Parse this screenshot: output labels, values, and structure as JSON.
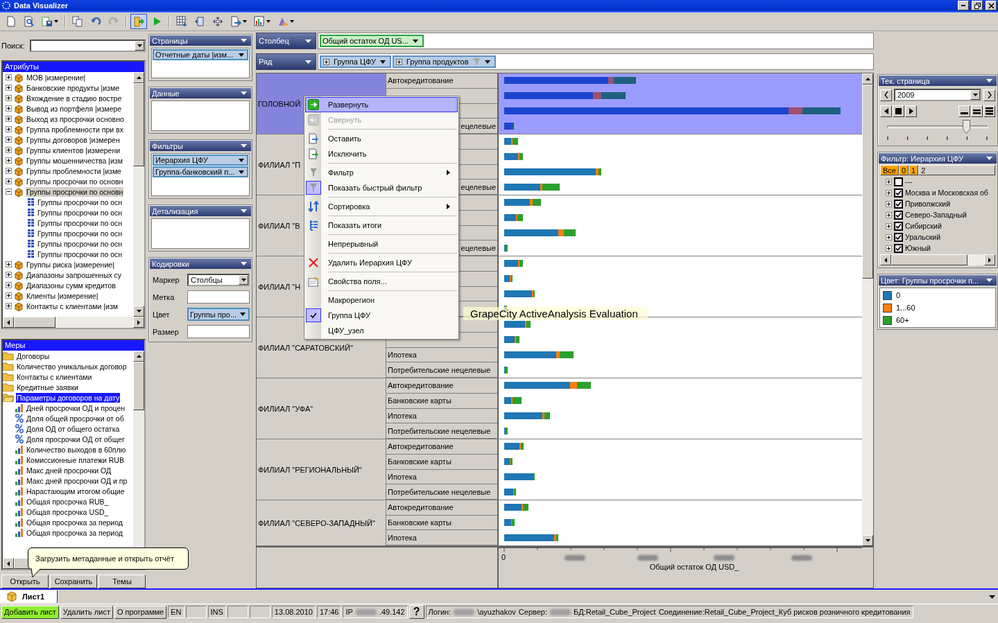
{
  "window": {
    "title": "Data Visualizer"
  },
  "toolbar": [
    {
      "kind": "new",
      "selected": false,
      "menu": false
    },
    {
      "kind": "preview",
      "selected": false,
      "menu": false
    },
    {
      "kind": "save",
      "selected": false,
      "menu": true
    },
    {
      "kind": "separator"
    },
    {
      "kind": "copy",
      "selected": false,
      "menu": false
    },
    {
      "kind": "undo",
      "selected": false,
      "menu": false
    },
    {
      "kind": "redo",
      "selected": false,
      "menu": false
    },
    {
      "kind": "separator"
    },
    {
      "kind": "open",
      "selected": true,
      "menu": false
    },
    {
      "kind": "run",
      "selected": false,
      "menu": false
    },
    {
      "kind": "separator"
    },
    {
      "kind": "grid",
      "selected": false,
      "menu": false
    },
    {
      "kind": "panel",
      "selected": false,
      "menu": false
    },
    {
      "kind": "move",
      "selected": false,
      "menu": false
    },
    {
      "kind": "export",
      "selected": false,
      "menu": true
    },
    {
      "kind": "chart",
      "selected": false,
      "menu": true
    },
    {
      "kind": "paint",
      "selected": false,
      "menu": true
    }
  ],
  "search": {
    "label": "Поиск:"
  },
  "attributes": {
    "title": "Атрибуты",
    "items": [
      {
        "label": "МОВ  |измерение|",
        "expanded": false,
        "selected": false
      },
      {
        "label": "Банковские продукты  |изме",
        "expanded": false,
        "selected": false
      },
      {
        "label": "Вхождение в стадию востре",
        "expanded": false,
        "selected": false
      },
      {
        "label": "Вывод из портфеля  |измере",
        "expanded": false,
        "selected": false
      },
      {
        "label": "Выход из просрочки основно",
        "expanded": false,
        "selected": false
      },
      {
        "label": "Группа проблемности при вх",
        "expanded": false,
        "selected": false
      },
      {
        "label": "Группы договоров  |измерен",
        "expanded": false,
        "selected": false
      },
      {
        "label": "Группы клиентов  |измерени",
        "expanded": false,
        "selected": false
      },
      {
        "label": "Группы мошенничества  |изм",
        "expanded": false,
        "selected": false
      },
      {
        "label": "Группы проблемности  |изме",
        "expanded": false,
        "selected": false
      },
      {
        "label": "Группы просрочки по основн",
        "expanded": false,
        "selected": false
      },
      {
        "label": "Группы просрочки по основн",
        "expanded": true,
        "selected": true,
        "children": [
          {
            "label": "Группы просрочки по осн",
            "selected": false
          },
          {
            "label": "Группы просрочки по осн",
            "selected": false
          },
          {
            "label": "Группы просрочки по осн",
            "selected": false
          },
          {
            "label": "Группы просрочки по осн",
            "selected": false
          },
          {
            "label": "Группы просрочки по осн",
            "selected": false
          },
          {
            "label": "Группы просрочки по осн",
            "selected": false
          }
        ]
      },
      {
        "label": "Группы риска  |измерение|",
        "expanded": false,
        "selected": false
      },
      {
        "label": "Диапазоны запрошенных су",
        "expanded": false,
        "selected": false
      },
      {
        "label": "Диапазоны сумм кредитов",
        "expanded": false,
        "selected": false
      },
      {
        "label": "Клиенты  |измерение|",
        "expanded": false,
        "selected": false
      },
      {
        "label": "Контакты с клиентами  |изм",
        "expanded": false,
        "selected": false
      }
    ]
  },
  "measures": {
    "title": "Меры",
    "items": [
      {
        "label": "Договоры",
        "expanded": false,
        "selected": false
      },
      {
        "label": "Количество уникальных договор",
        "expanded": false,
        "selected": false
      },
      {
        "label": "Контакты с клиентами",
        "expanded": false,
        "selected": false
      },
      {
        "label": "Кредитные заявки",
        "expanded": false,
        "selected": false
      },
      {
        "label": "Параметры договоров на дату",
        "expanded": true,
        "selected": true,
        "children": [
          {
            "label": "Дней просрочки ОД и процен",
            "kind": "measure",
            "selected": false
          },
          {
            "label": "Доля общей просрочки от об",
            "kind": "percent",
            "selected": false
          },
          {
            "label": "Доля ОД от общего остатка",
            "kind": "percent",
            "selected": false
          },
          {
            "label": "Доля просрочки ОД от общег",
            "kind": "percent",
            "selected": false
          },
          {
            "label": "Количество выходов в 60плю",
            "kind": "measure",
            "selected": false
          },
          {
            "label": "Комиссионные платежи RUB",
            "kind": "measure",
            "selected": false
          },
          {
            "label": "Макс дней просрочки ОД",
            "kind": "measure",
            "selected": false
          },
          {
            "label": "Макс дней просрочки ОД и пр",
            "kind": "measure",
            "selected": false
          },
          {
            "label": "Нарастающим итогом общие",
            "kind": "measure",
            "selected": false
          },
          {
            "label": "Общая просрочка RUB_",
            "kind": "measure",
            "selected": false
          },
          {
            "label": "Общая просрочка USD_",
            "kind": "measure",
            "selected": false
          },
          {
            "label": "Общая просрочка за период",
            "kind": "measure",
            "selected": false
          },
          {
            "label": "Общая просрочка за период",
            "kind": "measure",
            "selected": false
          }
        ]
      }
    ]
  },
  "tooltip": "Загрузить метаданные и открыть отчёт",
  "buttons": [
    "Открыть",
    "Сохранить",
    "Темы"
  ],
  "panels": [
    {
      "title": "Страницы",
      "fields": [
        "Отчетные даты  |изм..."
      ]
    },
    {
      "title": "Данные"
    },
    {
      "title": "Фильтры",
      "fields": [
        "Иерархия ЦФУ",
        "Группа-банковский  п..."
      ]
    },
    {
      "title": "Детализация"
    }
  ],
  "encodings": {
    "title": "Кодировки",
    "rows": [
      {
        "label": "Маркер",
        "kind": "dropdown",
        "value": "Столбцы"
      },
      {
        "label": "Метка",
        "kind": "empty"
      },
      {
        "label": "Цвет",
        "kind": "chip",
        "value": "Группы  про..."
      },
      {
        "label": "Размер",
        "kind": "empty"
      }
    ]
  },
  "column_shelf": {
    "label": "Столбец",
    "fields": [
      {
        "label": "Общий остаток  ОД  US...",
        "filter": false
      }
    ]
  },
  "row_shelf": {
    "label": "Ряд",
    "fields": [
      {
        "label": "Группа ЦФУ",
        "filter": false
      },
      {
        "label": "Группа продуктов",
        "filter": true
      }
    ]
  },
  "table": {
    "groups": [
      {
        "label": "ГОЛОВНОЙ",
        "selected": true,
        "rows": [
          {
            "kind": "full",
            "label": "Автокредитование"
          },
          {
            "kind": "covered"
          },
          {
            "kind": "covered"
          },
          {
            "kind": "cut",
            "label": "ецелевые"
          }
        ]
      },
      {
        "label": "ФИЛИАЛ \"П",
        "selected": false,
        "rows": [
          {
            "kind": "covered"
          },
          {
            "kind": "covered"
          },
          {
            "kind": "covered"
          },
          {
            "kind": "cut",
            "label": "ецелевые"
          }
        ]
      },
      {
        "label": "ФИЛИАЛ \"В",
        "selected": false,
        "rows": [
          {
            "kind": "covered"
          },
          {
            "kind": "covered"
          },
          {
            "kind": "covered"
          },
          {
            "kind": "cut",
            "label": "ецелевые"
          }
        ]
      },
      {
        "label": "ФИЛИАЛ \"Н",
        "selected": false,
        "rows": [
          {
            "kind": "covered"
          },
          {
            "kind": "covered"
          },
          {
            "kind": "covered"
          },
          {
            "kind": "covered"
          }
        ]
      },
      {
        "label": "ФИЛИАЛ \"САРАТОВСКИЙ\"",
        "selected": false,
        "rows": [
          {
            "kind": "covered"
          },
          {
            "kind": "covered"
          },
          {
            "kind": "full",
            "label": "Ипотека"
          },
          {
            "kind": "full",
            "label": "Потребительские нецелевые"
          }
        ]
      },
      {
        "label": "ФИЛИАЛ \"УФА\"",
        "selected": false,
        "rows": [
          {
            "kind": "full",
            "label": "Автокредитование"
          },
          {
            "kind": "full",
            "label": "Банковские карты"
          },
          {
            "kind": "full",
            "label": "Ипотека"
          },
          {
            "kind": "full",
            "label": "Потребительские нецелевые"
          }
        ]
      },
      {
        "label": "ФИЛИАЛ \"РЕГИОНАЛЬНЫЙ\"",
        "selected": false,
        "rows": [
          {
            "kind": "full",
            "label": "Автокредитование"
          },
          {
            "kind": "full",
            "label": "Банковские карты"
          },
          {
            "kind": "full",
            "label": "Ипотека"
          },
          {
            "kind": "full",
            "label": "Потребительские нецелевые"
          }
        ]
      },
      {
        "label": "ФИЛИАЛ \"СЕВЕРО-ЗАПАДНЫЙ\"",
        "selected": false,
        "rows": [
          {
            "kind": "full",
            "label": "Автокредитование"
          },
          {
            "kind": "full",
            "label": "Банковские карты"
          },
          {
            "kind": "full",
            "label": "Ипотека"
          }
        ]
      }
    ],
    "axis": {
      "ticks": [
        "0"
      ],
      "title": "Общий остаток ОД USD_"
    }
  },
  "context_menu": {
    "groups": [
      [
        {
          "label": "Развернуть",
          "kind": "expand",
          "selected": true,
          "disabled": false,
          "checked": false,
          "submenu": false
        },
        {
          "label": "Свернуть",
          "kind": "collapse",
          "selected": false,
          "disabled": true,
          "checked": false,
          "submenu": false
        }
      ],
      [
        {
          "label": "Оставить",
          "kind": "keep",
          "selected": false,
          "disabled": false,
          "checked": false,
          "submenu": false
        },
        {
          "label": "Исключить",
          "kind": "exclude",
          "selected": false,
          "disabled": false,
          "checked": false,
          "submenu": false
        }
      ],
      [
        {
          "label": "Фильтр",
          "kind": "filter",
          "selected": false,
          "disabled": false,
          "checked": false,
          "submenu": true
        },
        {
          "label": "Показать быстрый фильтр",
          "kind": "filter",
          "selected": false,
          "disabled": false,
          "checked": true,
          "submenu": false
        }
      ],
      [
        {
          "label": "Сортировка",
          "kind": "sort",
          "selected": false,
          "disabled": false,
          "checked": false,
          "submenu": true
        }
      ],
      [
        {
          "label": "Показать итоги",
          "kind": "totals",
          "selected": false,
          "disabled": false,
          "checked": false,
          "submenu": false
        }
      ],
      [
        {
          "label": "Непрерывный",
          "kind": "plain",
          "selected": false,
          "disabled": false,
          "checked": false,
          "submenu": false
        }
      ],
      [
        {
          "label": "Удалить Иерархия ЦФУ",
          "kind": "delete",
          "selected": false,
          "disabled": false,
          "checked": false,
          "submenu": false
        }
      ],
      [
        {
          "label": "Свойства поля...",
          "kind": "props",
          "selected": false,
          "disabled": false,
          "checked": false,
          "submenu": false
        }
      ],
      [
        {
          "label": "Макрорегион",
          "kind": "plain",
          "selected": false,
          "disabled": false,
          "checked": false,
          "submenu": false
        },
        {
          "label": "Группа ЦФУ",
          "kind": "plain",
          "selected": false,
          "disabled": false,
          "checked": true,
          "submenu": false
        },
        {
          "label": "ЦФУ_узел",
          "kind": "plain",
          "selected": false,
          "disabled": false,
          "checked": false,
          "submenu": false
        }
      ]
    ]
  },
  "evaluation_banner": "GrapeCity ActiveAnalysis Evaluation",
  "current_page": {
    "title": "Тек. страница",
    "value": "2009",
    "level": 0.78
  },
  "filter_panel": {
    "title": "Фильтр: Иерархия ЦФУ",
    "levels": [
      {
        "label": "Все",
        "selected": true
      },
      {
        "label": "0",
        "selected": true
      },
      {
        "label": "1",
        "selected": true
      },
      {
        "label": "2",
        "selected": false
      }
    ],
    "items": [
      {
        "label": "---",
        "checked": false
      },
      {
        "label": "Москва и Московская об",
        "checked": true
      },
      {
        "label": "Приволжский",
        "checked": true
      },
      {
        "label": "Северо-Западный",
        "checked": true
      },
      {
        "label": "Сибирский",
        "checked": true
      },
      {
        "label": "Уральский",
        "checked": true
      },
      {
        "label": "Южный",
        "checked": true
      }
    ]
  },
  "legend": {
    "title": "Цвет: Группы просрочки п...",
    "items": [
      {
        "label": "0",
        "color": "#1f77b4"
      },
      {
        "label": "1...60",
        "color": "#ff7f0e"
      },
      {
        "label": "60+",
        "color": "#2ca02c"
      }
    ]
  },
  "sheet_tabs": [
    {
      "label": "Лист1",
      "selected": true
    }
  ],
  "status_bar": [
    {
      "kind": "button",
      "label": "Добавить лист",
      "highlighted": true
    },
    {
      "kind": "button",
      "label": "Удалить лист",
      "highlighted": false
    },
    {
      "kind": "button",
      "label": "О программе",
      "highlighted": false
    },
    {
      "kind": "cell",
      "label": "EN"
    },
    {
      "kind": "blank"
    },
    {
      "kind": "cell",
      "label": "INS"
    },
    {
      "kind": "blank"
    },
    {
      "kind": "blank"
    },
    {
      "kind": "cell",
      "label": "13.08.2010"
    },
    {
      "kind": "cell",
      "label": "17:46"
    },
    {
      "kind": "parts",
      "parts": [
        {
          "kind": "text",
          "text": "IP"
        },
        {
          "kind": "redacted"
        },
        {
          "kind": "text",
          "text": ".49.142"
        }
      ]
    },
    {
      "kind": "help",
      "label": "?"
    },
    {
      "kind": "parts",
      "parts": [
        {
          "kind": "text",
          "text": "Логин:"
        },
        {
          "kind": "redacted"
        },
        {
          "kind": "text",
          "text": "\\ayuzhakov"
        },
        {
          "kind": "text",
          "text": "Сервер:"
        },
        {
          "kind": "redacted"
        },
        {
          "kind": "text",
          "text": "БД:Retail_Cube_Project"
        },
        {
          "kind": "text",
          "text": "Соединение:Retail_Cube_Project_Куб рисков розничного кредитования"
        }
      ]
    }
  ]
}
